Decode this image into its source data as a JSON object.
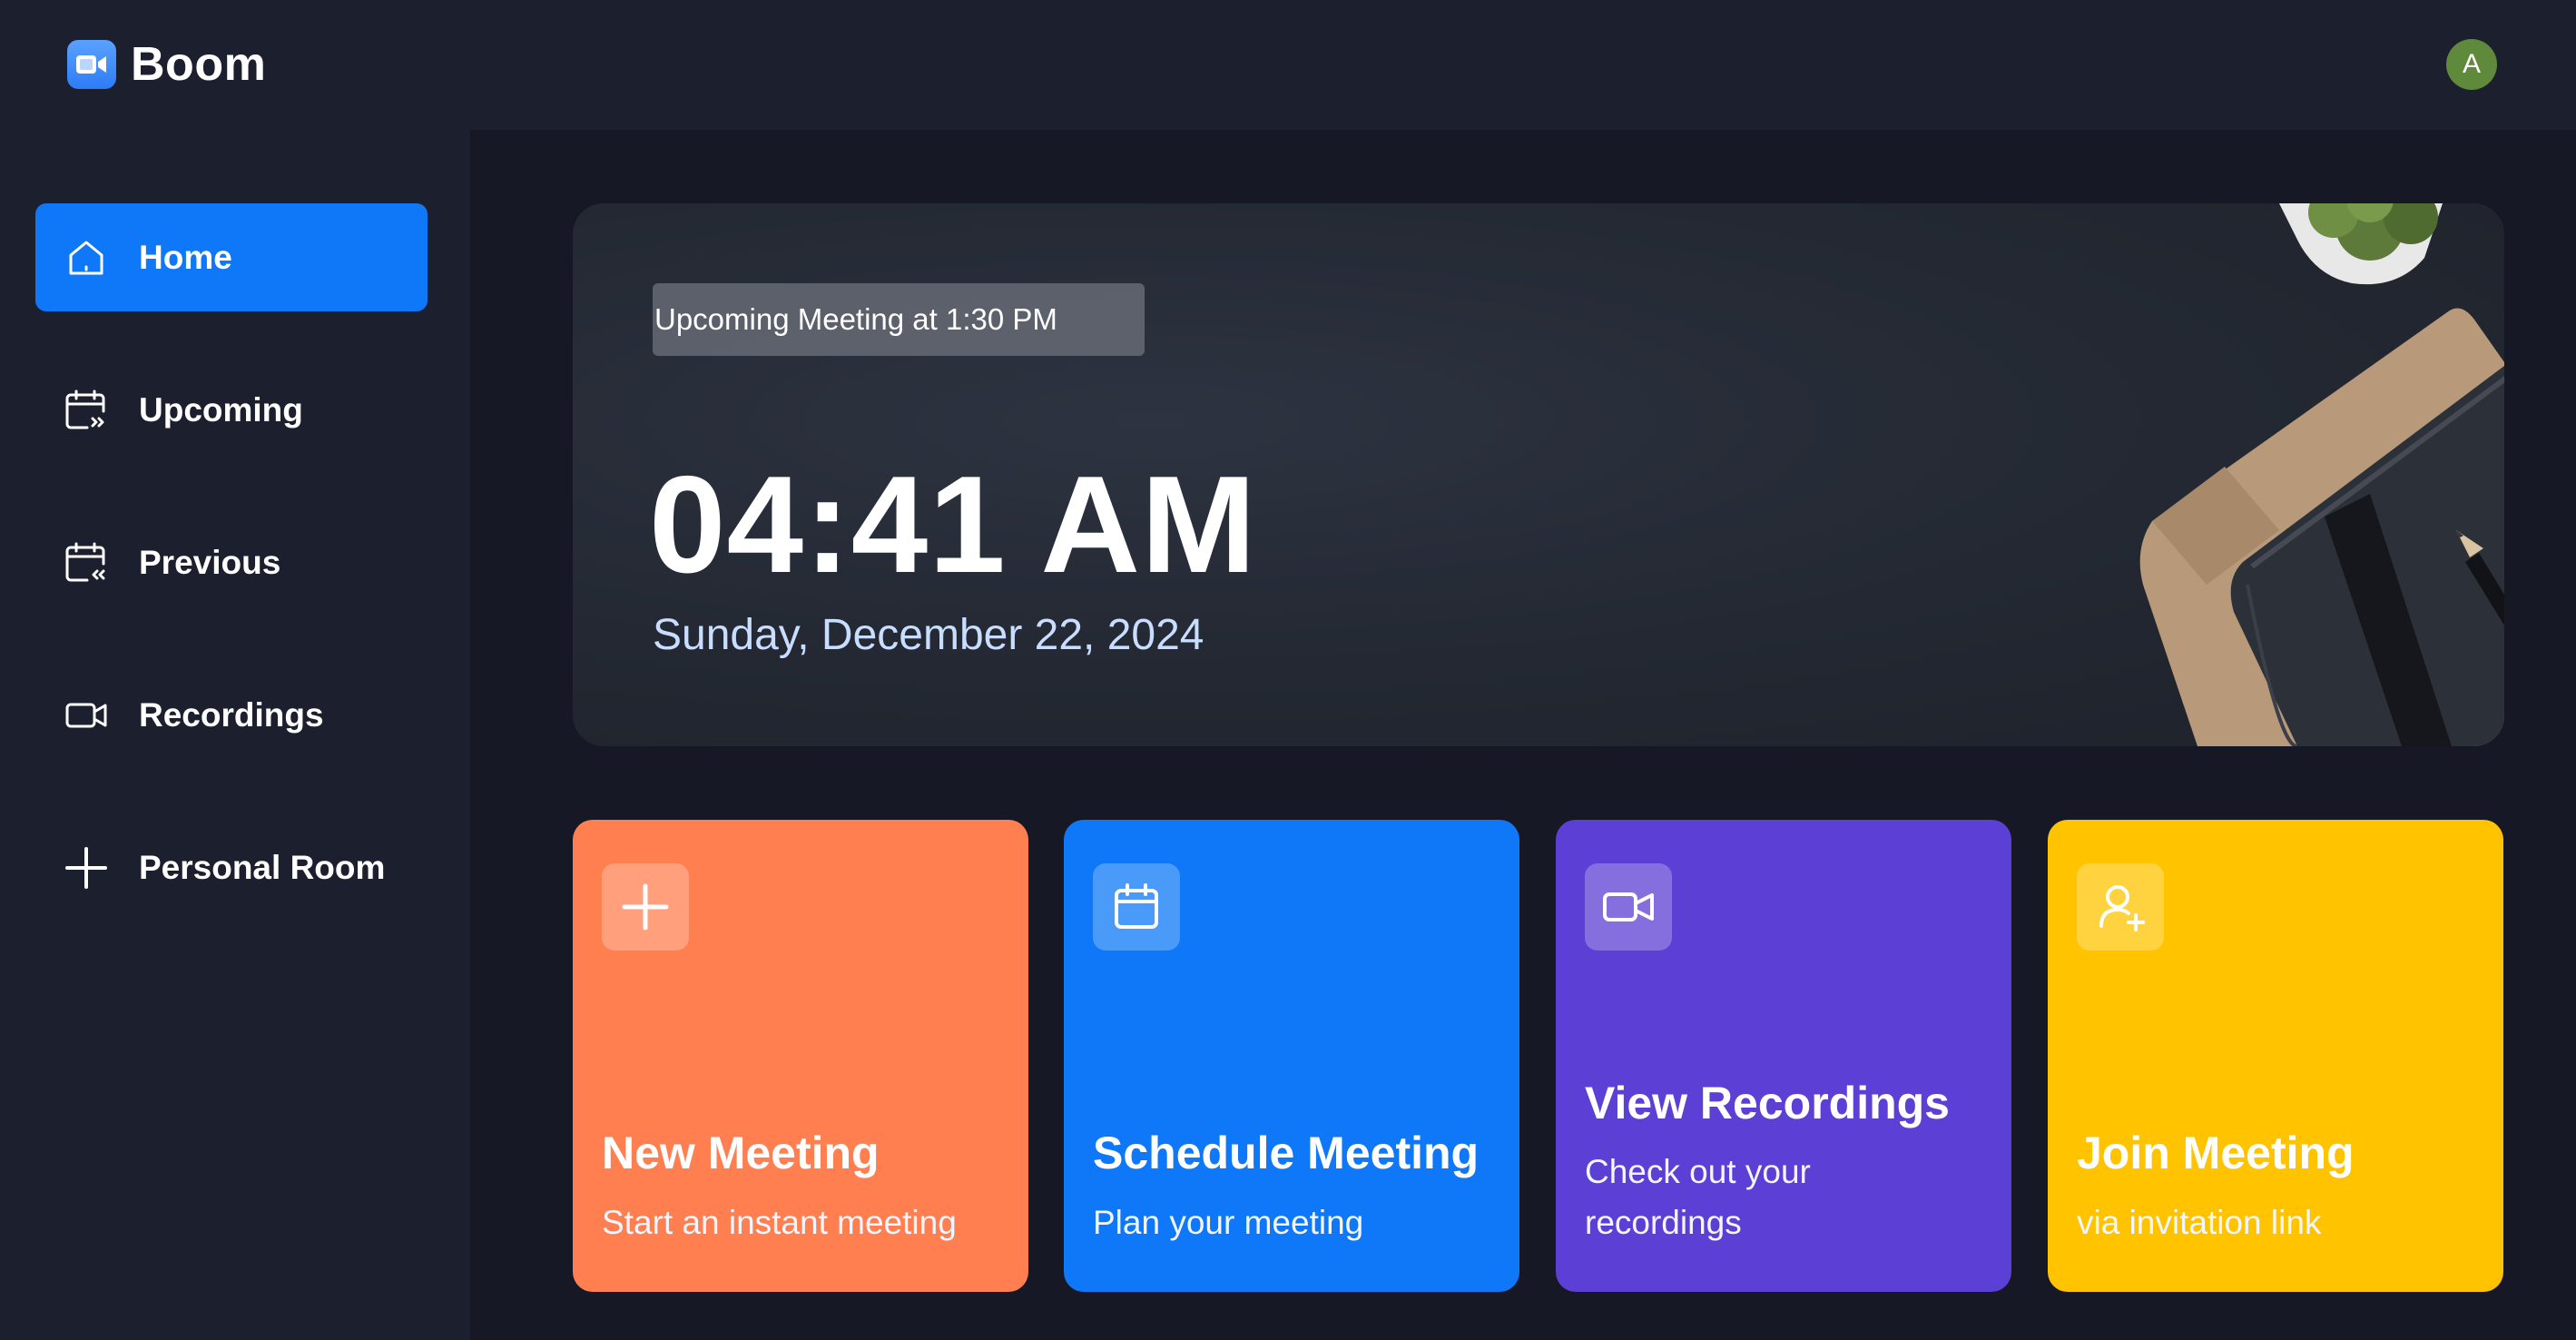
{
  "app": {
    "name": "Boom",
    "avatar_initial": "A",
    "avatar_color": "#5f8a3b",
    "brand_color": "#0e78f9"
  },
  "sidebar": {
    "items": [
      {
        "label": "Home",
        "icon": "home-icon",
        "active": true
      },
      {
        "label": "Upcoming",
        "icon": "calendar-upcoming-icon",
        "active": false
      },
      {
        "label": "Previous",
        "icon": "calendar-previous-icon",
        "active": false
      },
      {
        "label": "Recordings",
        "icon": "video-icon",
        "active": false
      },
      {
        "label": "Personal Room",
        "icon": "plus-icon",
        "active": false
      }
    ]
  },
  "hero": {
    "badge": "Upcoming Meeting at 1:30 PM",
    "time": "04:41 AM",
    "date": "Sunday, December 22, 2024"
  },
  "cards": [
    {
      "title": "New Meeting",
      "subtitle": "Start an instant meeting",
      "icon": "plus-icon",
      "color": "#ff7f50"
    },
    {
      "title": "Schedule Meeting",
      "subtitle": "Plan your meeting",
      "icon": "calendar-icon",
      "color": "#0e78f9"
    },
    {
      "title": "View Recordings",
      "subtitle_line1": "Check out your",
      "subtitle_line2": "recordings",
      "icon": "video-icon",
      "color": "#5c3fd4"
    },
    {
      "title": "Join Meeting",
      "subtitle": "via invitation link",
      "icon": "user-plus-icon",
      "color": "#ffc300"
    }
  ]
}
